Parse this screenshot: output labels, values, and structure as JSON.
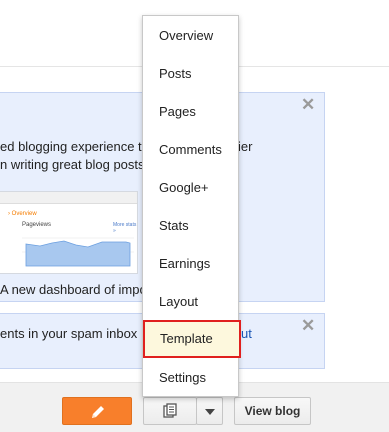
{
  "panel": {
    "line1": "ed blogging experience t",
    "line1_end": "ier",
    "line2": "n writing great blog posts",
    "caption": "A new dashboard of impo",
    "close_symbol": "✕",
    "thumbnail": {
      "nav_item": "› Overview",
      "card_title": "Pageviews",
      "card_link": "More stats »"
    }
  },
  "spam_panel": {
    "text": "ents in your spam inbox",
    "link_fragment": "ut",
    "close_symbol": "✕"
  },
  "bottom_bar": {
    "edit_button_icon": "pencil-icon",
    "view_blog_label": "View blog"
  },
  "dropdown_menu": {
    "items": [
      {
        "label": "Overview"
      },
      {
        "label": "Posts"
      },
      {
        "label": "Pages"
      },
      {
        "label": "Comments"
      },
      {
        "label": "Google+"
      },
      {
        "label": "Stats"
      },
      {
        "label": "Earnings"
      },
      {
        "label": "Layout"
      },
      {
        "label": "Template"
      },
      {
        "label": "Settings"
      }
    ],
    "selected": "Template",
    "highlight_color": "#e0201e"
  },
  "colors": {
    "accent_orange": "#f87f2b",
    "panel_blue": "#e8effd"
  }
}
